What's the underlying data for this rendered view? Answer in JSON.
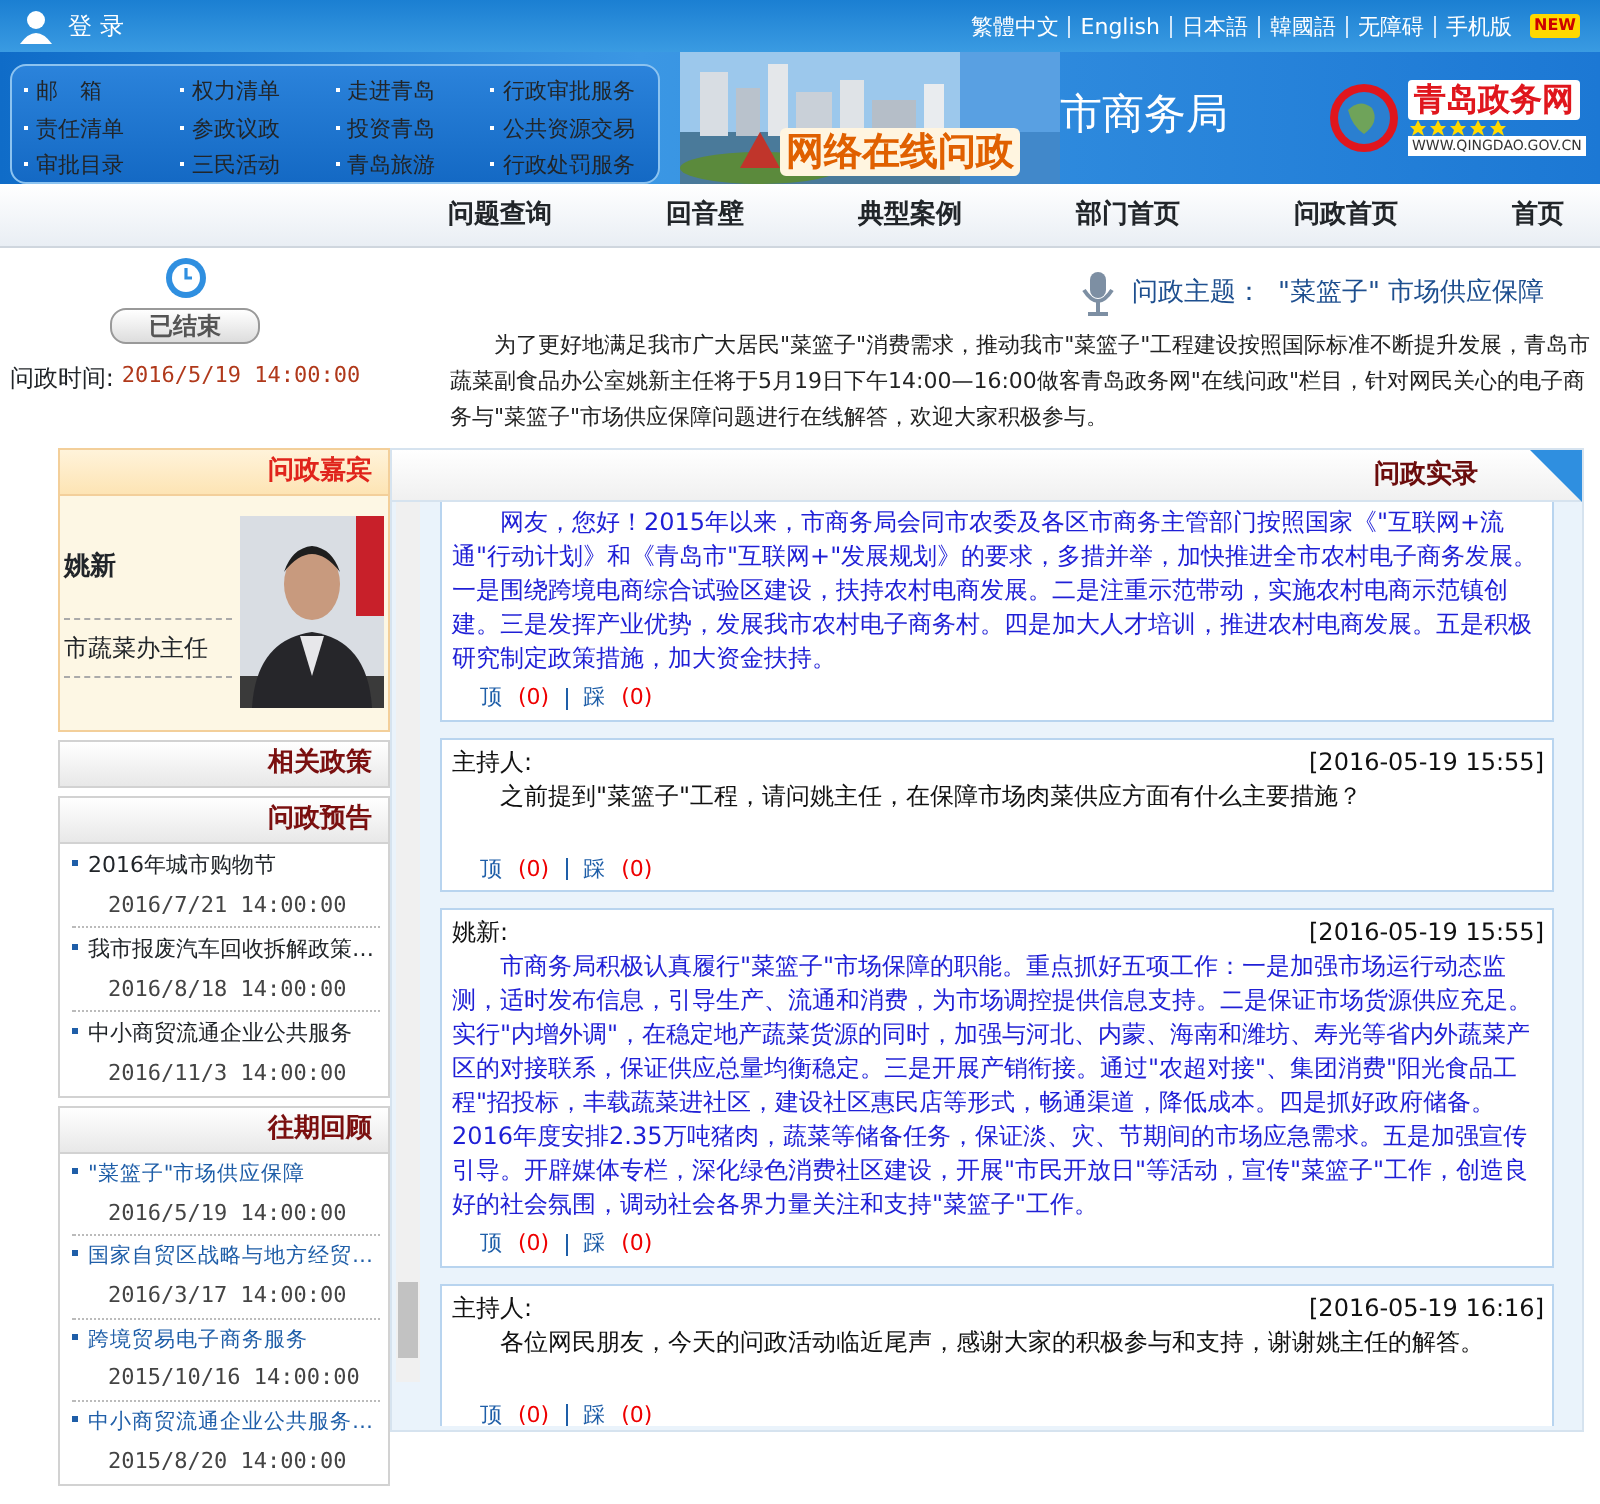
{
  "top_links": [
    "繁體中文",
    "English",
    "日本語",
    "韓國語",
    "无障碍",
    "手机版"
  ],
  "new_badge": "NEW",
  "login": "登 录",
  "logo": {
    "name": "青岛政务网",
    "url": "WWW.QINGDAO.GOV.CN"
  },
  "department": "市商务局",
  "banner_title": "网络在线问政",
  "quick_links": [
    "邮　箱",
    "权力清单",
    "走进青岛",
    "行政审批服务",
    "责任清单",
    "参政议政",
    "投资青岛",
    "公共资源交易",
    "审批目录",
    "三民活动",
    "青岛旅游",
    "行政处罚服务"
  ],
  "nav": [
    "问题查询",
    "回音壁",
    "典型案例",
    "部门首页",
    "问政首页",
    "首页"
  ],
  "topic": {
    "label": "问政主题：",
    "title": "\"菜篮子\" 市场供应保障",
    "intro": "为了更好地满足我市广大居民\"菜篮子\"消费需求，推动我市\"菜篮子\"工程建设按照国际标准不断提升发展，青岛市蔬菜副食品办公室姚新主任将于5月19日下午14:00—16:00做客青岛政务网\"在线问政\"栏目，针对网民关心的电子商务与\"菜篮子\"市场供应保障问题进行在线解答，欢迎大家积极参与。",
    "status": "已结束",
    "time_label": "问政时间:",
    "time": "2016/5/19 14:00:00"
  },
  "record": {
    "title": "问政实录",
    "posts": [
      {
        "kind": "answer",
        "text": "网友，您好！2015年以来，市商务局会同市农委及各区市商务主管部门按照国家《\"互联网+流通\"行动计划》和《青岛市\"互联网+\"发展规划》的要求，多措并举，加快推进全市农村电子商务发展。一是围绕跨境电商综合试验区建设，扶持农村电商发展。二是注重示范带动，实施农村电商示范镇创建。三是发挥产业优势，发展我市农村电子商务村。四是加大人才培训，推进农村电商发展。五是积极研究制定政策措施，加大资金扶持。",
        "up": "顶",
        "up_count": "(0)",
        "down": "踩",
        "down_count": "(0)"
      },
      {
        "kind": "question",
        "author": "主持人:",
        "time": "[2016-05-19 15:55]",
        "text": "之前提到\"菜篮子\"工程，请问姚主任，在保障市场肉菜供应方面有什么主要措施？",
        "up": "顶",
        "up_count": "(0)",
        "down": "踩",
        "down_count": "(0)"
      },
      {
        "kind": "answer",
        "author": "姚新:",
        "time": "[2016-05-19 15:55]",
        "text": "市商务局积极认真履行\"菜篮子\"市场保障的职能。重点抓好五项工作：一是加强市场运行动态监测，适时发布信息，引导生产、流通和消费，为市场调控提供信息支持。二是保证市场货源供应充足。实行\"内增外调\"，在稳定地产蔬菜货源的同时，加强与河北、内蒙、海南和潍坊、寿光等省内外蔬菜产区的对接联系，保证供应总量均衡稳定。三是开展产销衔接。通过\"农超对接\"、集团消费\"阳光食品工程\"招投标，丰载蔬菜进社区，建设社区惠民店等形式，畅通渠道，降低成本。四是抓好政府储备。2016年度安排2.35万吨猪肉，蔬菜等储备任务，保证淡、灾、节期间的市场应急需求。五是加强宣传引导。开辟媒体专栏，深化绿色消费社区建设，开展\"市民开放日\"等活动，宣传\"菜篮子\"工作，创造良好的社会氛围，调动社会各界力量关注和支持\"菜篮子\"工作。",
        "up": "顶",
        "up_count": "(0)",
        "down": "踩",
        "down_count": "(0)"
      },
      {
        "kind": "question",
        "author": "主持人:",
        "time": "[2016-05-19 16:16]",
        "text": "各位网民朋友，今天的问政活动临近尾声，感谢大家的积极参与和支持，谢谢姚主任的解答。",
        "up": "顶",
        "up_count": "(0)",
        "down": "踩",
        "down_count": "(0)"
      }
    ]
  },
  "guest": {
    "title": "问政嘉宾",
    "name": "姚新",
    "position": "市蔬菜办主任"
  },
  "policy": {
    "title": "相关政策"
  },
  "upcoming": {
    "title": "问政预告",
    "items": [
      {
        "title": "2016年城市购物节",
        "time": "2016/7/21 14:00:00"
      },
      {
        "title": "我市报废汽车回收拆解政策…",
        "time": "2016/8/18 14:00:00"
      },
      {
        "title": "中小商贸流通企业公共服务",
        "time": "2016/11/3 14:00:00"
      }
    ]
  },
  "past": {
    "title": "往期回顾",
    "items": [
      {
        "title": "\"菜篮子\"市场供应保障",
        "time": "2016/5/19 14:00:00"
      },
      {
        "title": "国家自贸区战略与地方经贸…",
        "time": "2016/3/17 14:00:00"
      },
      {
        "title": "跨境贸易电子商务服务",
        "time": "2015/10/16 14:00:00"
      },
      {
        "title": "中小商贸流通企业公共服务…",
        "time": "2015/8/20 14:00:00"
      }
    ]
  }
}
